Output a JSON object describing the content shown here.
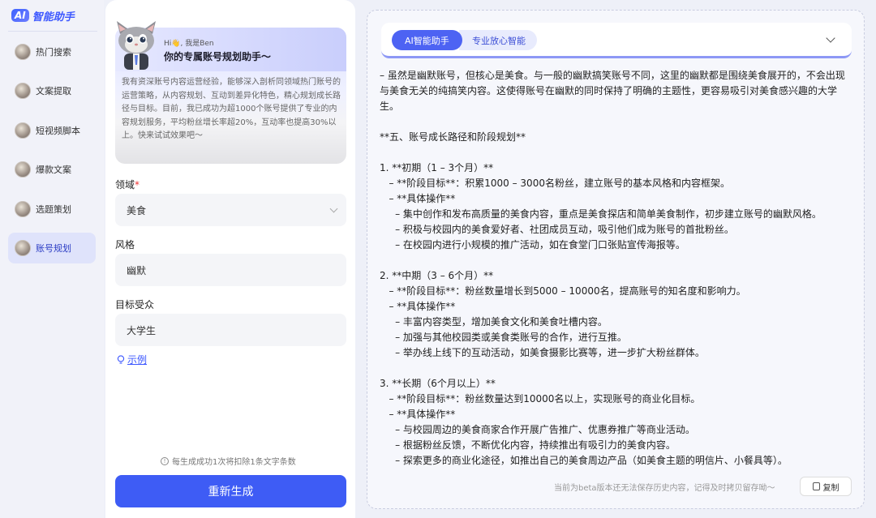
{
  "app": {
    "logo_badge": "AI",
    "logo_text": "智能助手"
  },
  "nav": {
    "items": [
      {
        "label": "热门搜索",
        "icon": "cat-avatar-icon"
      },
      {
        "label": "文案提取",
        "icon": "cat-avatar-icon"
      },
      {
        "label": "短视频脚本",
        "icon": "cat-avatar-icon"
      },
      {
        "label": "爆款文案",
        "icon": "cat-avatar-icon"
      },
      {
        "label": "选题策划",
        "icon": "cat-avatar-icon"
      },
      {
        "label": "账号规划",
        "icon": "cat-avatar-icon",
        "active": true
      }
    ]
  },
  "hero": {
    "greeting": "Hi👋, 我是Ben",
    "title": "你的专属账号规划助手～",
    "description": "我有资深账号内容运营经验，能够深入剖析同领域热门账号的运营策略，从内容规划、互动到差异化特色，精心规划成长路径与目标。目前，我已成功为超1000个账号提供了专业的内容规划服务，平均粉丝增长率超20%，互动率也提高30%以上。快来试试效果吧～"
  },
  "form": {
    "domain_label": "领域",
    "domain_required": "*",
    "domain_value": "美食",
    "style_label": "风格",
    "style_value": "幽默",
    "audience_label": "目标受众",
    "audience_value": "大学生",
    "example_link": "示例",
    "gen_note": "每生成成功1次将扣除1条文字条数",
    "regenerate_button": "重新生成"
  },
  "output": {
    "tab_active": "AI智能助手",
    "tab_inactive": "专业放心智能",
    "lines": [
      "  – 虽然是幽默账号，但核心是美食。与一般的幽默搞笑账号不同，这里的幽默都是围绕美食展开的，不会出现与美食无关的纯搞笑内容。这使得账号在幽默的同时保持了明确的主题性，更容易吸引对美食感兴趣的大学生。",
      "",
      "**五、账号成长路径和阶段规划**",
      "",
      "1. **初期（1 – 3个月）**",
      "   – **阶段目标**：积累1000 – 3000名粉丝，建立账号的基本风格和内容框架。",
      "   – **具体操作**",
      "     – 集中创作和发布高质量的美食内容，重点是美食探店和简单美食制作，初步建立账号的幽默风格。",
      "     – 积极与校园内的美食爱好者、社团成员互动，吸引他们成为账号的首批粉丝。",
      "     – 在校园内进行小规模的推广活动，如在食堂门口张贴宣传海报等。",
      "",
      "2. **中期（3 – 6个月）**",
      "   – **阶段目标**：粉丝数量增长到5000 – 10000名，提高账号的知名度和影响力。",
      "   – **具体操作**",
      "     – 丰富内容类型，增加美食文化和美食吐槽内容。",
      "     – 加强与其他校园类或美食类账号的合作，进行互推。",
      "     – 举办线上线下的互动活动，如美食摄影比赛等，进一步扩大粉丝群体。",
      "",
      "3. **长期（6个月以上）**",
      "   – **阶段目标**：粉丝数量达到10000名以上，实现账号的商业化目标。",
      "   – **具体操作**",
      "     – 与校园周边的美食商家合作开展广告推广、优惠券推广等商业活动。",
      "     – 根据粉丝反馈，不断优化内容，持续推出有吸引力的美食内容。",
      "     – 探索更多的商业化途径，如推出自己的美食周边产品（如美食主题的明信片、小餐具等）。"
    ],
    "footer_note": "当前为beta版本还无法保存历史内容，记得及时拷贝留存呦～",
    "copy_button": "复制"
  }
}
